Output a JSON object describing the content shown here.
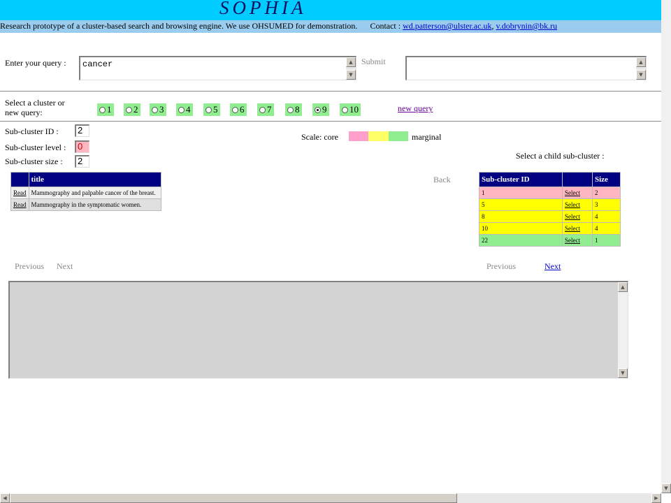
{
  "header": {
    "logo": "SOPHIA",
    "description": "Research prototype of a cluster-based search and browsing engine. We use OHSUMED for demonstration.",
    "contact_label": "Contact :",
    "contact_email_1": "wd.patterson@ulster.ac.uk",
    "contact_sep": ",",
    "contact_email_2": "v.dobrynin@bk.ru"
  },
  "query": {
    "label": "Enter your query :",
    "value": "cancer",
    "submit_label": "Submit"
  },
  "clusters": {
    "label_line1": "Select a cluster  or",
    "label_line2": "new query:",
    "options": [
      "1",
      "2",
      "3",
      "4",
      "5",
      "6",
      "7",
      "8",
      "9",
      "10"
    ],
    "selected": "9",
    "new_query_label": "new query"
  },
  "subcluster": {
    "id_label": "Sub-cluster ID :",
    "id_value": "2",
    "level_label": "Sub-cluster level :",
    "level_value": "0",
    "size_label": "Sub-cluster size :",
    "size_value": "2"
  },
  "scale": {
    "label": "Scale:",
    "core": "core",
    "marginal": "marginal",
    "colors": [
      "#ffa0cc",
      "#ffff66",
      "#90ee90"
    ]
  },
  "child_select_label": "Select a child sub-cluster :",
  "back_label": "Back",
  "documents": {
    "header": "title",
    "rows": [
      {
        "action": "Read",
        "title": "Mammography and palpable cancer of the breast."
      },
      {
        "action": "Read",
        "title": "Mammography in the symptomatic women."
      }
    ]
  },
  "child_table": {
    "headers": [
      "Sub-cluster ID",
      "",
      "Size"
    ],
    "rows": [
      {
        "id": "1",
        "action": "Select",
        "size": "2",
        "color": "#ffb6c1"
      },
      {
        "id": "5",
        "action": "Select",
        "size": "3",
        "color": "#ffff00"
      },
      {
        "id": "8",
        "action": "Select",
        "size": "4",
        "color": "#ffff00"
      },
      {
        "id": "10",
        "action": "Select",
        "size": "4",
        "color": "#ffff00"
      },
      {
        "id": "22",
        "action": "Select",
        "size": "1",
        "color": "#90ee90"
      }
    ]
  },
  "pagination_left": {
    "previous": "Previous",
    "next": "Next"
  },
  "pagination_right": {
    "previous": "Previous",
    "next": "Next"
  },
  "colors": {
    "topbar": "#00ccff",
    "infobar": "#99ccee",
    "table_header": "#000080"
  }
}
